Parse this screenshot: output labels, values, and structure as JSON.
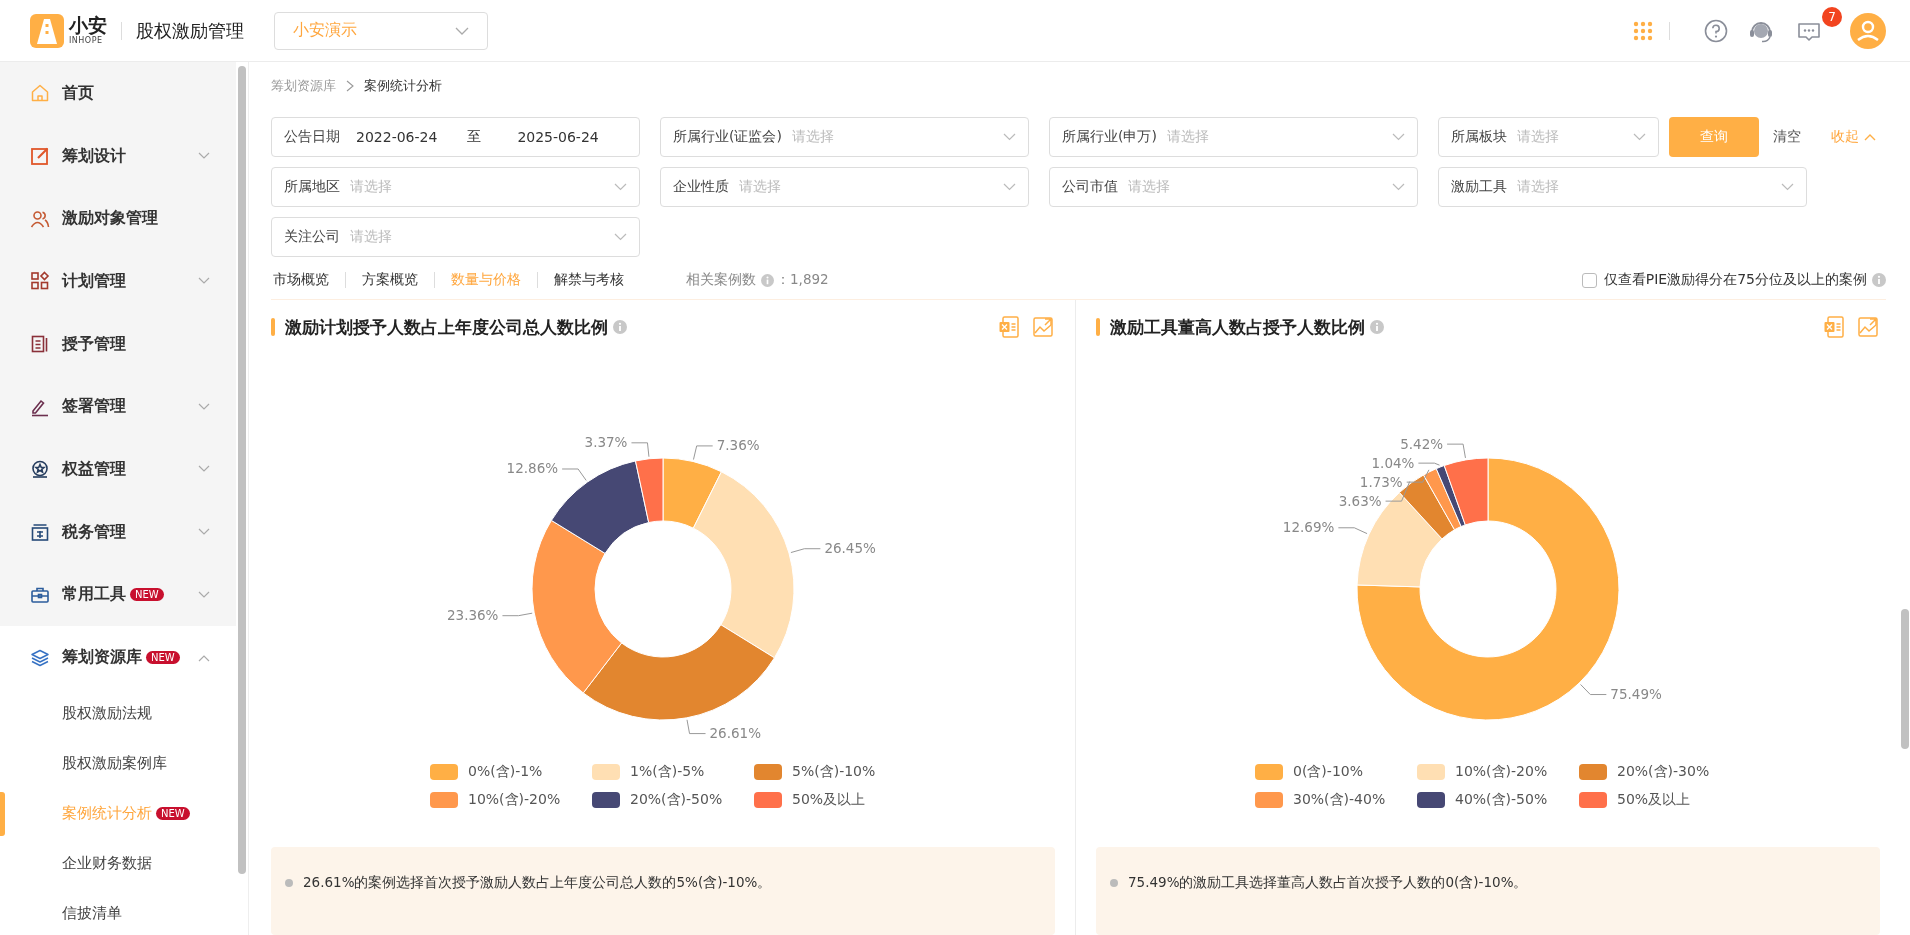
{
  "header": {
    "logo_text": "小安",
    "logo_sub": "INHOPE",
    "app_title": "股权激励管理",
    "company_select": "小安演示",
    "message_badge": "7"
  },
  "sidebar": {
    "items": [
      {
        "label": "首页"
      },
      {
        "label": "筹划设计",
        "expanded": false
      },
      {
        "label": "激励对象管理"
      },
      {
        "label": "计划管理",
        "expanded": false
      },
      {
        "label": "授予管理"
      },
      {
        "label": "签署管理",
        "expanded": false
      },
      {
        "label": "权益管理",
        "expanded": false
      },
      {
        "label": "税务管理",
        "expanded": false
      },
      {
        "label": "常用工具",
        "badge": "NEW",
        "expanded": false
      },
      {
        "label": "筹划资源库",
        "badge": "NEW",
        "expanded": true,
        "children": [
          {
            "label": "股权激励法规",
            "selected": false
          },
          {
            "label": "股权激励案例库",
            "selected": false
          },
          {
            "label": "案例统计分析",
            "badge": "NEW",
            "selected": true
          },
          {
            "label": "企业财务数据",
            "selected": false
          },
          {
            "label": "信披清单",
            "selected": false
          }
        ]
      }
    ]
  },
  "breadcrumb": [
    "筹划资源库",
    "案例统计分析"
  ],
  "filters": {
    "rows": [
      [
        {
          "kind": "date_range",
          "label": "公告日期",
          "from": "2022-06-24",
          "separator": "至",
          "to": "2025-06-24"
        },
        {
          "kind": "select",
          "label": "所属行业(证监会)",
          "placeholder": "请选择"
        },
        {
          "kind": "select",
          "label": "所属行业(申万)",
          "placeholder": "请选择"
        },
        {
          "kind": "select",
          "label": "所属板块",
          "placeholder": "请选择"
        }
      ],
      [
        {
          "kind": "select",
          "label": "所属地区",
          "placeholder": "请选择"
        },
        {
          "kind": "select",
          "label": "企业性质",
          "placeholder": "请选择"
        },
        {
          "kind": "select",
          "label": "公司市值",
          "placeholder": "请选择"
        },
        {
          "kind": "select",
          "label": "激励工具",
          "placeholder": "请选择"
        }
      ],
      [
        {
          "kind": "select",
          "label": "关注公司",
          "placeholder": "请选择"
        }
      ]
    ],
    "query_button": "查询",
    "clear_link": "清空",
    "collapse_link": "收起"
  },
  "tabs": [
    {
      "label": "市场概览",
      "selected": false
    },
    {
      "label": "方案概览",
      "selected": false
    },
    {
      "label": "数量与价格",
      "selected": true
    },
    {
      "label": "解禁与考核",
      "selected": false
    }
  ],
  "case_count": {
    "label": "相关案例数",
    "separator": "：",
    "value": "1,892"
  },
  "pie_filter": {
    "label": "仅查看PIE激励得分在75分位及以上的案例",
    "checked": false
  },
  "panels": [
    {
      "title": "激励计划授予人数占上年度公司总人数比例",
      "chart_data": {
        "type": "donut",
        "categories": [
          "0%(含)-1%",
          "1%(含)-5%",
          "5%(含)-10%",
          "10%(含)-20%",
          "20%(含)-50%",
          "50%及以上"
        ],
        "colors": [
          "#ffaf45",
          "#ffdfb3",
          "#e2862f",
          "#ff984c",
          "#464874",
          "#ff704a"
        ],
        "values": [
          7.36,
          26.45,
          26.61,
          23.36,
          12.86,
          3.37
        ],
        "value_labels": [
          "7.36%",
          "26.45%",
          "26.61%",
          "23.36%",
          "12.86%",
          "3.37%"
        ]
      },
      "insight": "26.61%的案例选择首次授予激励人数占上年度公司总人数的5%(含)-10%。"
    },
    {
      "title": "激励工具董高人数占授予人数比例",
      "chart_data": {
        "type": "donut",
        "categories": [
          "0(含)-10%",
          "10%(含)-20%",
          "20%(含)-30%",
          "30%(含)-40%",
          "40%(含)-50%",
          "50%及以上"
        ],
        "colors": [
          "#ffaf45",
          "#ffdfb3",
          "#e2862f",
          "#ff984c",
          "#464874",
          "#ff704a"
        ],
        "values": [
          75.49,
          12.69,
          3.63,
          1.73,
          1.04,
          5.42
        ],
        "value_labels": [
          "75.49%",
          "12.69%",
          "3.63%",
          "1.73%",
          "1.04%",
          "5.42%"
        ]
      },
      "insight": "75.49%的激励工具选择董高人数占首次授予人数的0(含)-10%。"
    }
  ]
}
